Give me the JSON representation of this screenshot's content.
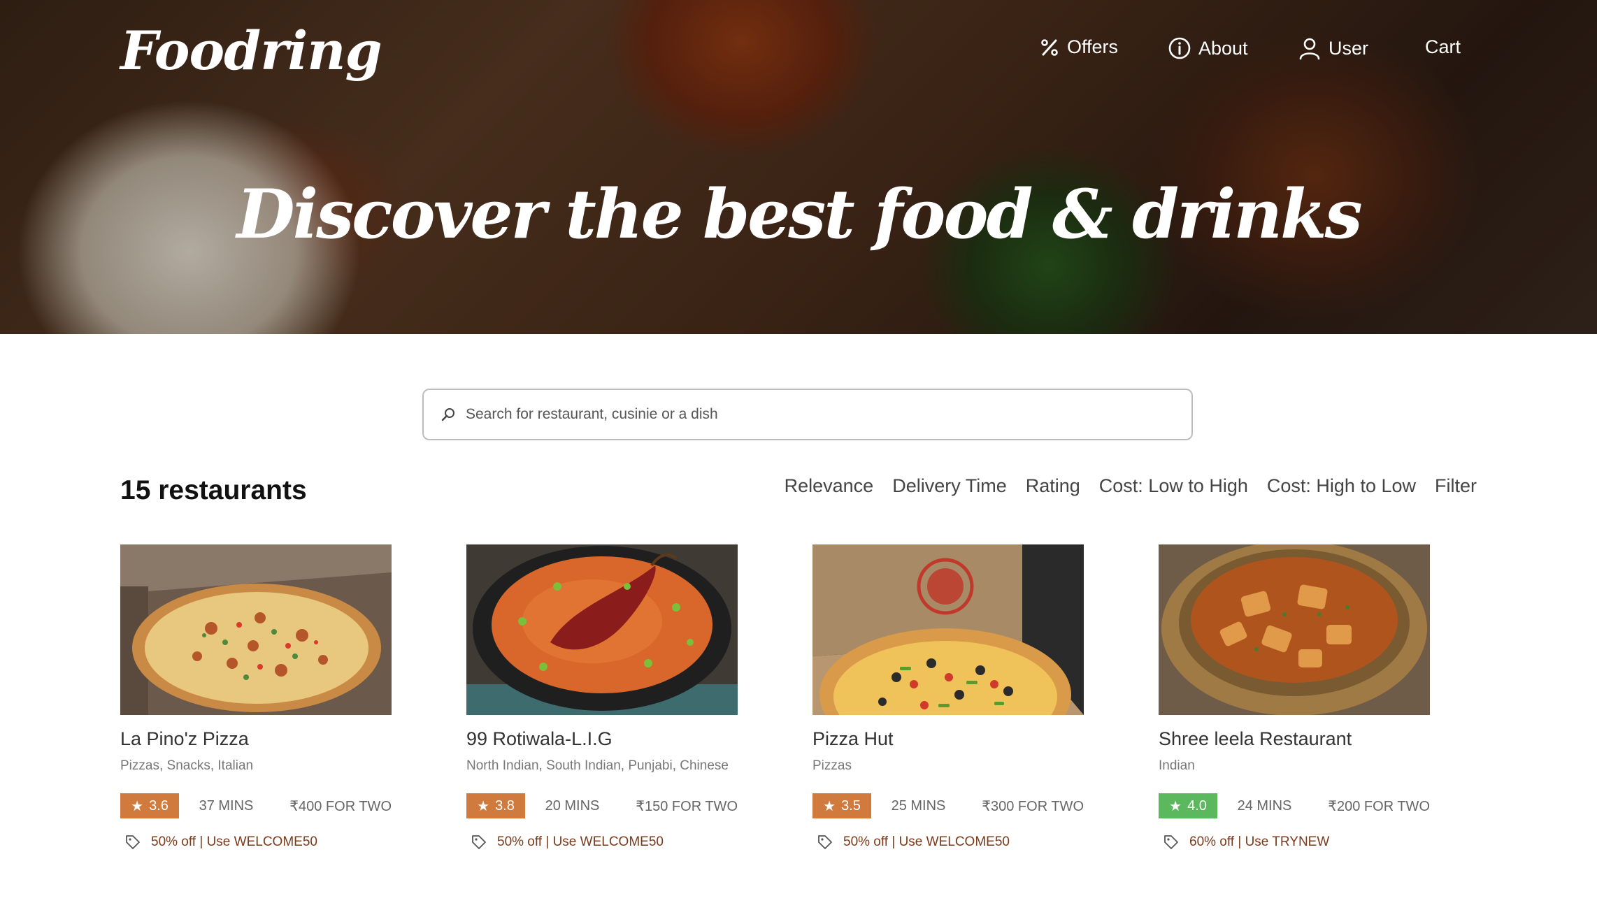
{
  "brand": {
    "logo": "Foodring"
  },
  "nav": {
    "offers": "Offers",
    "about": "About",
    "user": "User",
    "cart": "Cart"
  },
  "hero": {
    "tagline": "Discover the best food & drinks"
  },
  "search": {
    "placeholder": "Search for restaurant, cusinie or a dish"
  },
  "listing": {
    "count_label": "15 restaurants"
  },
  "sort_options": [
    "Relevance",
    "Delivery Time",
    "Rating",
    "Cost: Low to High",
    "Cost: High to Low",
    "Filter"
  ],
  "colors": {
    "rating_orange": "#d07a3e",
    "rating_green": "#5cb85c",
    "offer_text": "#7a3b1c"
  },
  "restaurants": [
    {
      "name": "La Pino'z Pizza",
      "cuisine": "Pizzas, Snacks, Italian",
      "rating": "3.6",
      "rating_color": "#d07a3e",
      "time": "37 MINS",
      "cost": "₹400 FOR TWO",
      "offer": "50% off | Use WELCOME50",
      "image": "pizza-in-box"
    },
    {
      "name": "99 Rotiwala-L.I.G",
      "cuisine": "North Indian, South Indian, Punjabi, Chinese",
      "rating": "3.8",
      "rating_color": "#d07a3e",
      "time": "20 MINS",
      "cost": "₹150 FOR TWO",
      "offer": "50% off | Use WELCOME50",
      "image": "curry-bowl"
    },
    {
      "name": "Pizza Hut",
      "cuisine": "Pizzas",
      "rating": "3.5",
      "rating_color": "#d07a3e",
      "time": "25 MINS",
      "cost": "₹300 FOR TWO",
      "offer": "50% off | Use WELCOME50",
      "image": "pizza-hut-box"
    },
    {
      "name": "Shree leela Restaurant",
      "cuisine": "Indian",
      "rating": "4.0",
      "rating_color": "#5cb85c",
      "time": "24 MINS",
      "cost": "₹200 FOR TWO",
      "offer": "60% off | Use TRYNEW",
      "image": "paneer-curry-bowl"
    }
  ]
}
